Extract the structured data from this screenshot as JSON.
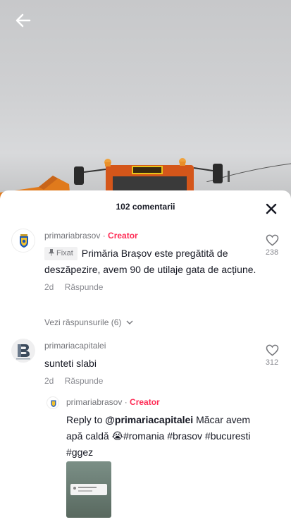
{
  "header": {
    "back_icon": "arrow-left-icon"
  },
  "comments_panel": {
    "count_label": "102 comentarii",
    "close_icon": "close-icon",
    "comments": [
      {
        "author": "primariabrasov",
        "separator": " · ",
        "badge": "Creator",
        "pinned_label": "Fixat",
        "text": "Primăria Brașov este pregătită de deszăpezire, avem 90 de utilaje gata de acțiune.",
        "age": "2d",
        "reply_label": "Răspunde",
        "likes": "238",
        "view_replies_label": "Vezi răspunsurile (6)"
      },
      {
        "author": "primariacapitalei",
        "text": "sunteti slabi",
        "age": "2d",
        "reply_label": "Răspunde",
        "likes": "312",
        "reply": {
          "author": "primariabrasov",
          "separator": " · ",
          "badge": "Creator",
          "reply_prefix": "Reply to ",
          "mention": "@primariacapitalei",
          "text_before_emoji": " Măcar avem apă caldă ",
          "emoji": "😭",
          "text_after_emoji": "#romania #brasov #bucuresti #ggez"
        }
      }
    ]
  },
  "colors": {
    "creator_accent": "#fe2c55",
    "text_primary": "#161823",
    "text_secondary": "#8a8b91"
  }
}
